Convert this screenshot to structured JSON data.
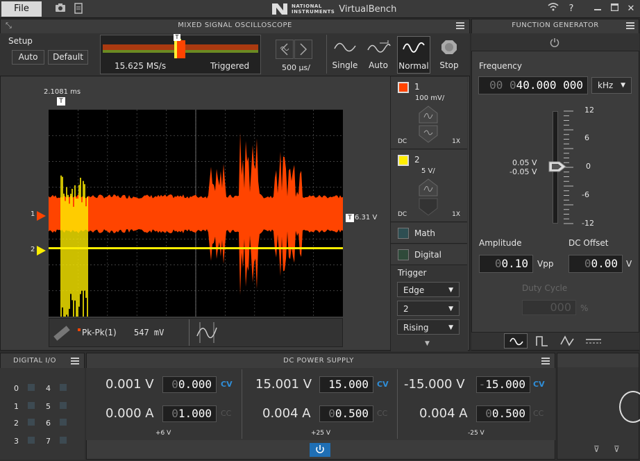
{
  "titlebar": {
    "file": "File",
    "brand_small": "NATIONAL\nINSTRUMENTS",
    "app_name": "VirtualBench"
  },
  "scope": {
    "title": "MIXED SIGNAL OSCILLOSCOPE",
    "setup_label": "Setup",
    "auto_btn": "Auto",
    "default_btn": "Default",
    "sample_rate": "15.625 MS/s",
    "trigger_state": "Triggered",
    "timebase": "500 µs/",
    "acq": {
      "single": "Single",
      "auto": "Auto",
      "normal": "Normal",
      "stop": "Stop"
    },
    "cursor_time": "2.1081 ms",
    "trigger_level": "6.31 V",
    "measure": {
      "label": "Pk-Pk(1)",
      "value": "547 mV"
    },
    "ch1": {
      "num": "1",
      "scale": "100 mV/",
      "coupling": "DC",
      "probe": "1X",
      "color": "#ff4400"
    },
    "ch2": {
      "num": "2",
      "scale": "5 V/",
      "coupling": "DC",
      "probe": "1X",
      "color": "#ffee00"
    },
    "math": "Math",
    "digital": "Digital",
    "trigger": {
      "title": "Trigger",
      "type": "Edge",
      "source": "2",
      "slope": "Rising"
    },
    "marker1": "1",
    "marker2": "2"
  },
  "fgen": {
    "title": "FUNCTION GENERATOR",
    "freq_label": "Frequency",
    "freq_dim": "00 0",
    "freq_val": "40.000 000",
    "freq_unit": "kHz",
    "scale": [
      "12",
      "6",
      "0",
      "-6",
      "-12"
    ],
    "high": "0.05 V",
    "low": "-0.05 V",
    "amp_label": "Amplitude",
    "amp_dim": "0",
    "amp_val": "0.10",
    "amp_unit": "Vpp",
    "off_label": "DC Offset",
    "off_dim": "0",
    "off_val": "0.00",
    "off_unit": "V",
    "duty_label": "Duty Cycle",
    "duty_val": "000",
    "duty_unit": "%"
  },
  "dio": {
    "title": "DIGITAL I/O",
    "pins": [
      "0",
      "4",
      "1",
      "5",
      "2",
      "6",
      "3",
      "7"
    ]
  },
  "dcps": {
    "title": "DC POWER SUPPLY",
    "ch": [
      {
        "v_read": "0.001 V",
        "v_dim": "0",
        "v_set": "0.000",
        "cv": "CV",
        "a_read": "0.000 A",
        "a_dim": "0",
        "a_set": "1.000",
        "cc": "CC",
        "label": "+6 V"
      },
      {
        "v_read": "15.001 V",
        "v_dim": "",
        "v_set": "15.000",
        "cv": "CV",
        "a_read": "0.004 A",
        "a_dim": "0",
        "a_set": "0.500",
        "cc": "CC",
        "label": "+25 V"
      },
      {
        "v_read": "-15.000 V",
        "v_dim": "-",
        "v_set": "15.000",
        "cv": "CV",
        "a_read": "0.004 A",
        "a_dim": "0",
        "a_set": "0.500",
        "cc": "CC",
        "label": "-25 V"
      }
    ]
  }
}
